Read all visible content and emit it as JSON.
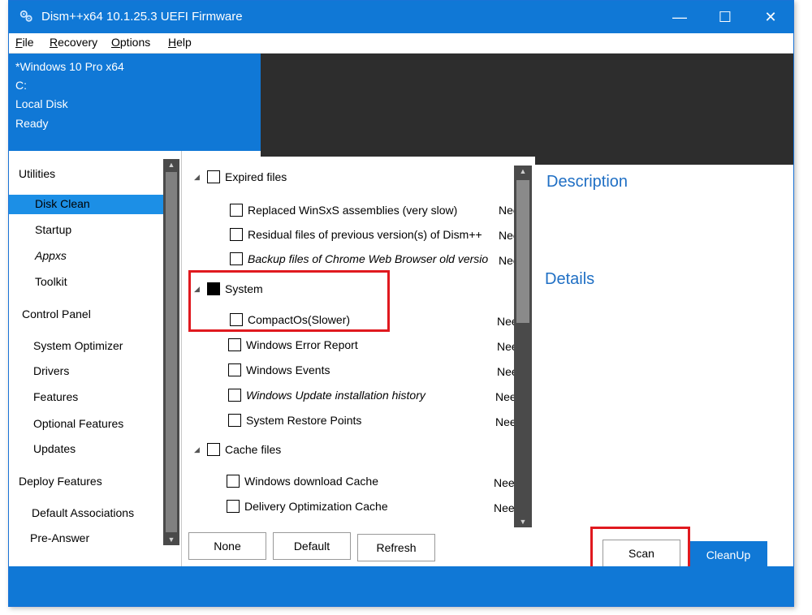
{
  "window": {
    "title": "Dism++x64 10.1.25.3 UEFI Firmware",
    "minimize": "—",
    "maximize": "☐",
    "close": "✕"
  },
  "menu": [
    {
      "label_u": "F",
      "label_rest": "ile"
    },
    {
      "label_u": "R",
      "label_rest": "ecovery"
    },
    {
      "label_u": "O",
      "label_rest": "ptions"
    },
    {
      "label_u": "H",
      "label_rest": "elp"
    }
  ],
  "info": {
    "os": "*Windows 10 Pro x64",
    "drive": "C:",
    "disk": "Local Disk",
    "status": "Ready"
  },
  "sidebar": {
    "utilities": "Utilities",
    "utilities_items": [
      "Disk Clean",
      "Startup",
      "Appxs",
      "Toolkit"
    ],
    "control_panel": "Control Panel",
    "control_items": [
      "System Optimizer",
      "Drivers",
      "Features",
      "Optional Features",
      "Updates"
    ],
    "deploy": "Deploy Features",
    "deploy_items": [
      "Default Associations",
      "Pre-Answer"
    ]
  },
  "tree": {
    "expired": "Expired files",
    "expired_items": [
      "Replaced WinSxS assemblies (very slow)",
      "Residual files of previous version(s) of Dism++",
      "Backup files of Chrome Web Browser old versio"
    ],
    "system": "System",
    "system_items": [
      "CompactOs(Slower)",
      "Windows Error Report",
      "Windows Events",
      "Windows Update installation history",
      "System Restore Points"
    ],
    "cache": "Cache files",
    "cache_items": [
      "Windows download Cache",
      "Delivery Optimization Cache"
    ],
    "need": "Nee"
  },
  "description": {
    "title": "Description",
    "details": "Details"
  },
  "buttons": {
    "none": "None",
    "default": "Default",
    "refresh": "Refresh",
    "scan": "Scan",
    "cleanup": "CleanUp"
  },
  "colors": {
    "accent": "#1078d6",
    "highlight": "#e0191f"
  }
}
